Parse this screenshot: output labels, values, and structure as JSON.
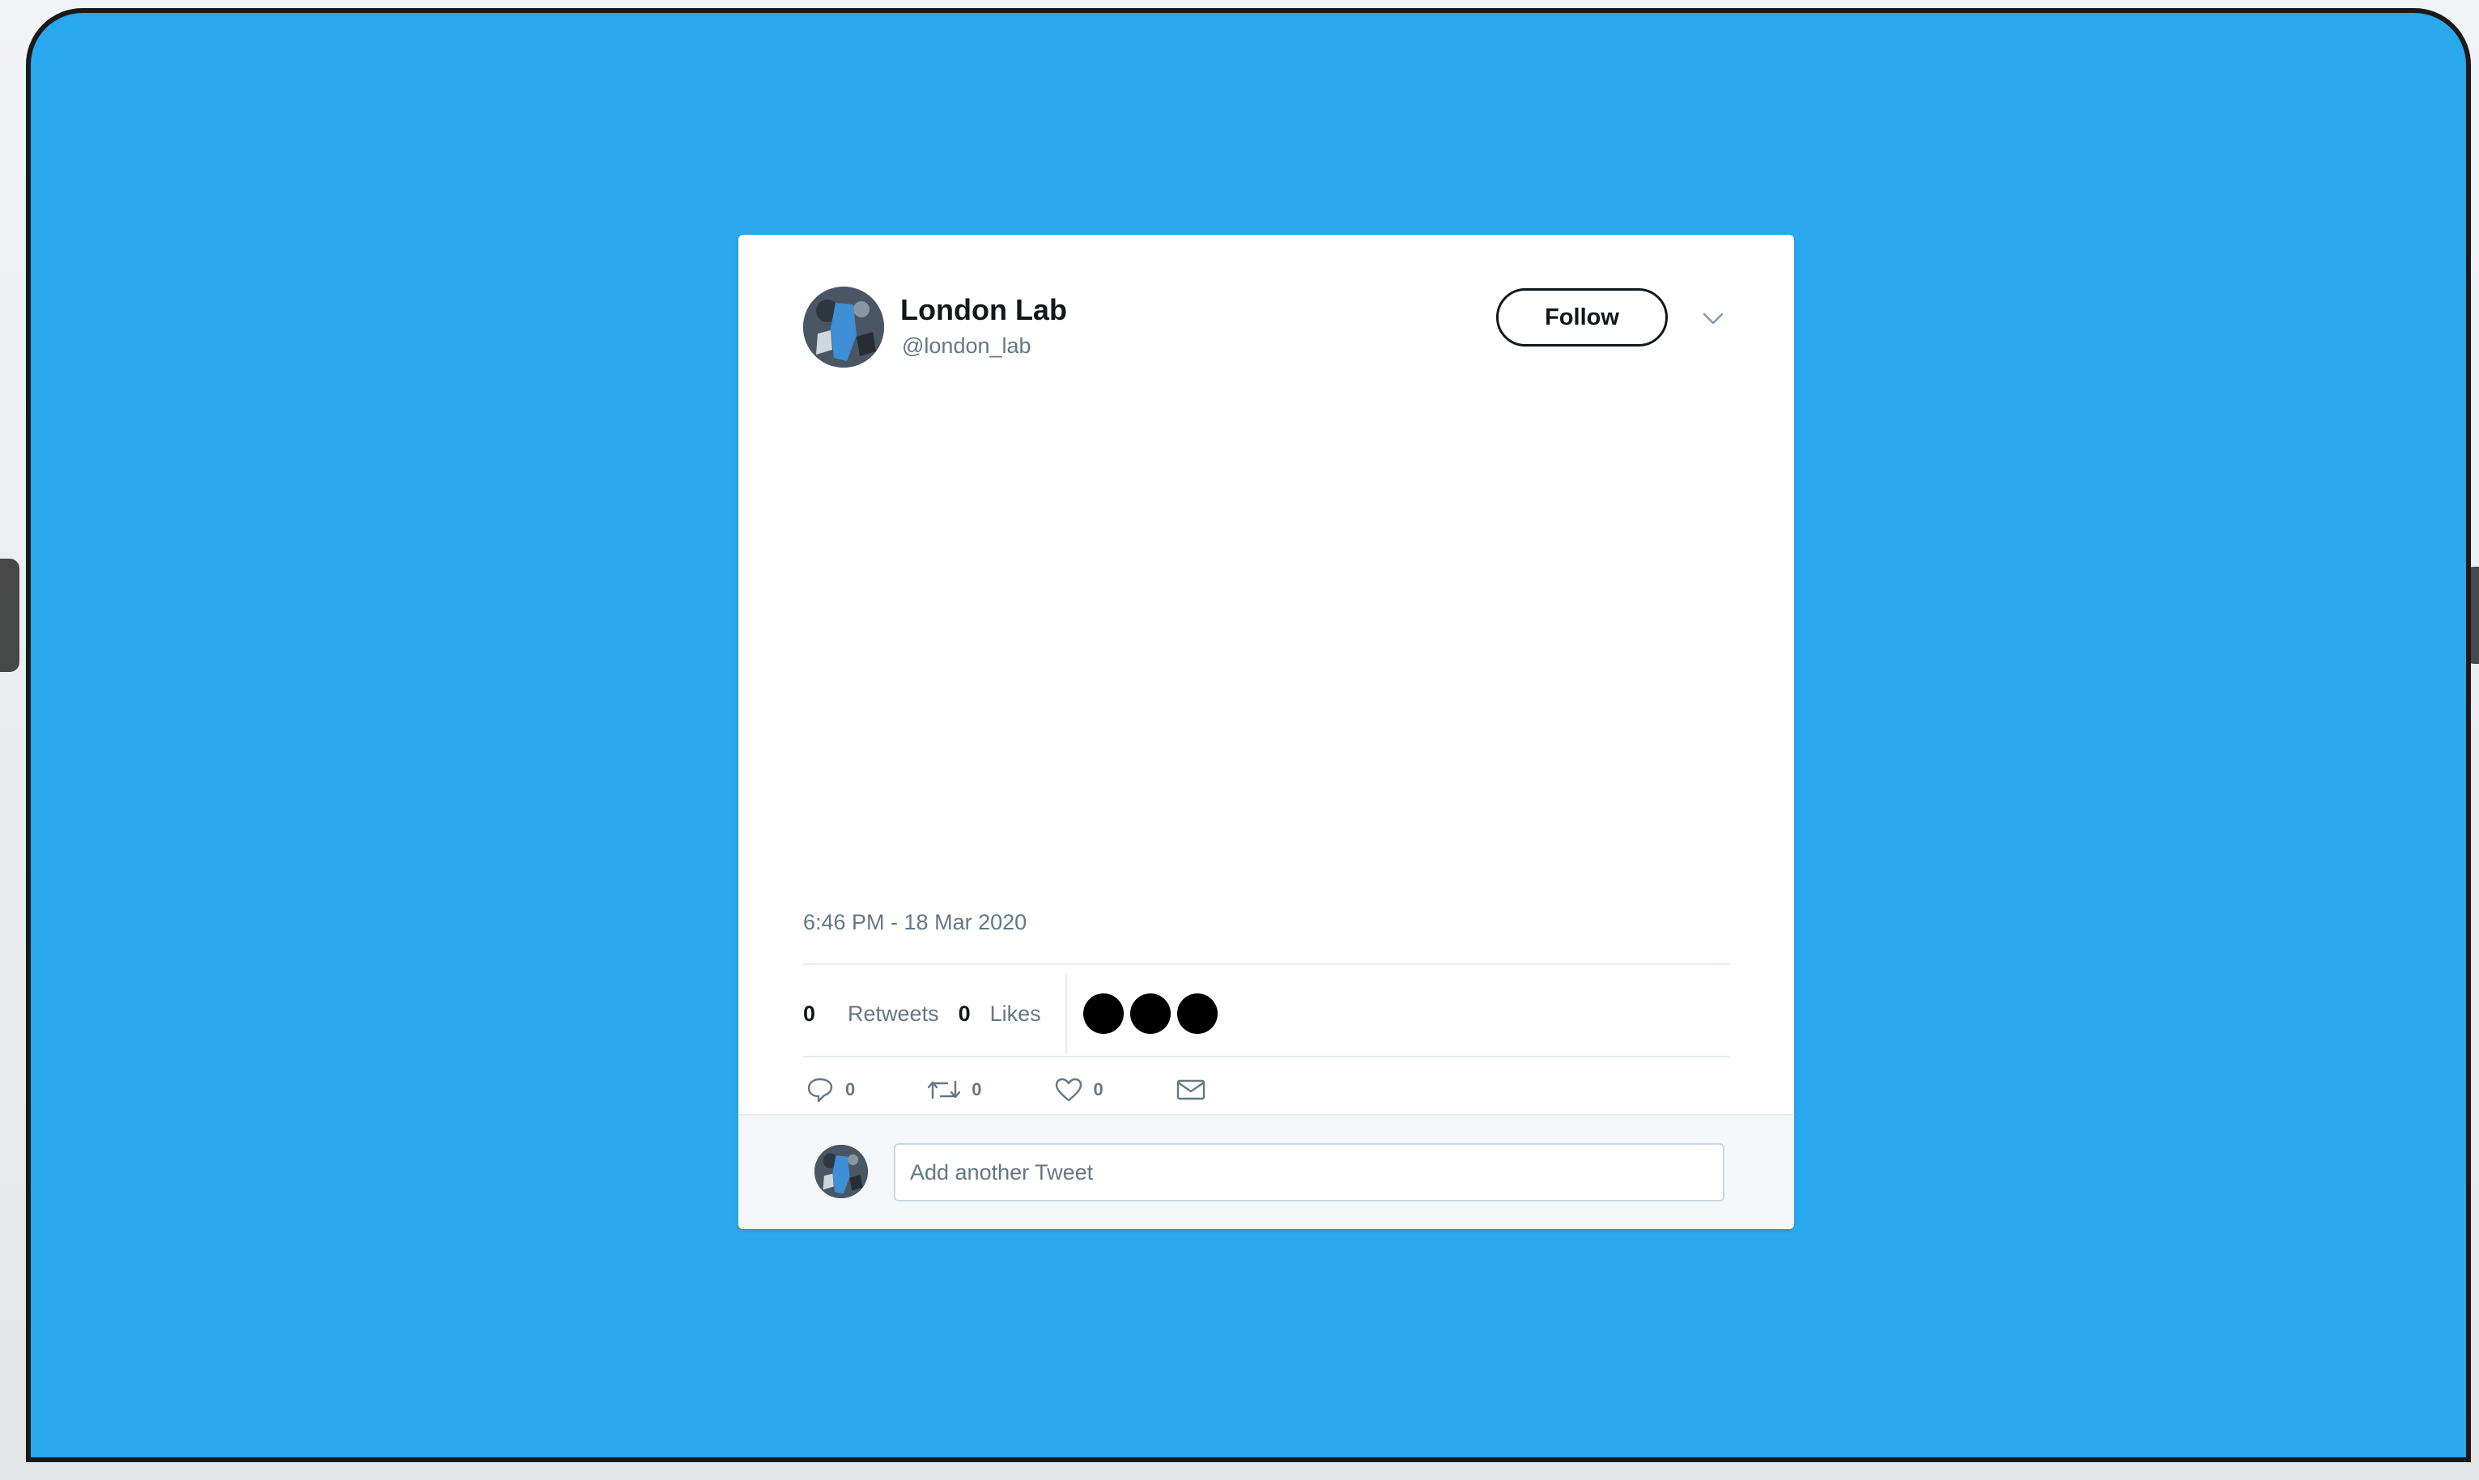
{
  "tweet": {
    "author_name": "London Lab",
    "author_handle": "@london_lab",
    "follow_label": "Follow",
    "timestamp": "6:46 PM - 18 Mar 2020",
    "stats": {
      "retweets_count": "0",
      "retweets_label": "Retweets",
      "likes_count": "0",
      "likes_label": "Likes"
    },
    "actions": {
      "reply_count": "0",
      "retweet_count": "0",
      "like_count": "0"
    }
  },
  "reply": {
    "placeholder": "Add another Tweet"
  },
  "colors": {
    "background": "#2aa8ee",
    "card": "#ffffff",
    "text_primary": "#14171a",
    "text_secondary": "#657786"
  },
  "icons": {
    "more": "chevron-down-icon",
    "reply": "comment-icon",
    "retweet": "retweet-icon",
    "like": "heart-icon",
    "message": "envelope-icon"
  }
}
